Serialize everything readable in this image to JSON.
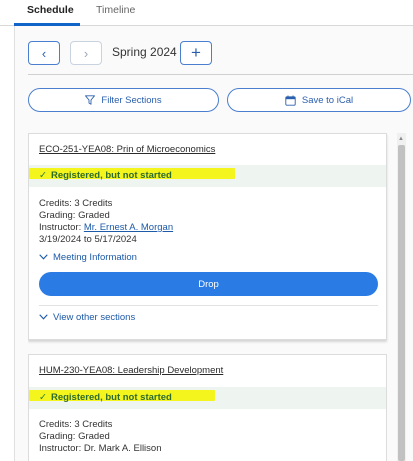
{
  "tabs": {
    "schedule": "Schedule",
    "timeline": "Timeline"
  },
  "term": {
    "label": "Spring 2024",
    "prev_symbol": "‹",
    "next_symbol": "›",
    "add_symbol": "+"
  },
  "actions": {
    "filter_label": "Filter Sections",
    "ical_label": "Save to iCal"
  },
  "courses": [
    {
      "title": "ECO-251-YEA08: Prin of Microeconomics",
      "status": "Registered, but not started",
      "credits": "Credits: 3 Credits",
      "grading": "Grading: Graded",
      "instructor_prefix": "Instructor: ",
      "instructor_name": "Mr. Ernest A. Morgan",
      "dates": "3/19/2024 to 5/17/2024",
      "meeting_label": "Meeting Information",
      "drop_label": "Drop",
      "other_sections_label": "View other sections"
    },
    {
      "title": "HUM-230-YEA08: Leadership Development",
      "status": "Registered, but not started",
      "credits": "Credits: 3 Credits",
      "grading": "Grading: Graded",
      "instructor": "Instructor: Dr. Mark A. Ellison"
    }
  ],
  "colors": {
    "accent": "#2a7be4",
    "link": "#1d5aa8",
    "highlight": "#f3f51c",
    "status_bg": "#eef5f0",
    "status_text": "#2e6b2e"
  },
  "icons": {
    "filter": "filter-icon",
    "calendar": "calendar-icon",
    "check": "check-icon",
    "chevron": "chevron-down-icon"
  }
}
